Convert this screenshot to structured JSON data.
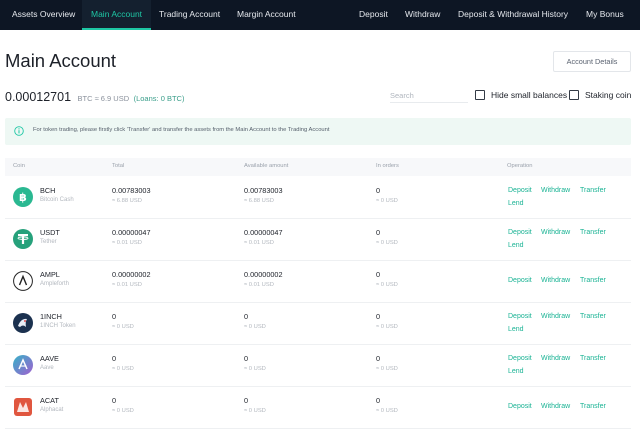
{
  "nav": {
    "left": [
      "Assets Overview",
      "Main Account",
      "Trading Account",
      "Margin Account"
    ],
    "right": [
      "Deposit",
      "Withdraw",
      "Deposit & Withdrawal History",
      "My Bonus"
    ]
  },
  "page": {
    "title": "Main Account",
    "details_label": "Account Details"
  },
  "balance": {
    "amount": "0.00012701",
    "sub": "BTC ≈ 6.9 USD",
    "loans": "(Loans: 0 BTC)"
  },
  "filters": {
    "search_placeholder": "Search",
    "hide_small_label": "Hide small balances",
    "staking_label": "Staking coin"
  },
  "notice": {
    "text": "For token trading, please firstly click 'Transfer' and transfer the assets from the Main Account to the Trading Account"
  },
  "table": {
    "headers": [
      "Coin",
      "Total",
      "Available amount",
      "In orders",
      "Operation"
    ],
    "op_labels": {
      "deposit": "Deposit",
      "withdraw": "Withdraw",
      "transfer": "Transfer",
      "lend": "Lend"
    },
    "rows": [
      {
        "symbol": "BCH",
        "name": "Bitcoin Cash",
        "icon": "bch-icon",
        "color": "#2ab891",
        "total": "0.00783003",
        "total_usd": "≈ 6.88 USD",
        "available": "0.00783003",
        "available_usd": "≈ 6.88 USD",
        "in_orders": "0",
        "in_orders_usd": "≈ 0 USD",
        "ops": [
          "deposit",
          "withdraw",
          "transfer",
          "lend"
        ]
      },
      {
        "symbol": "USDT",
        "name": "Tether",
        "icon": "usdt-icon",
        "color": "#26a17b",
        "total": "0.00000047",
        "total_usd": "≈ 0.01 USD",
        "available": "0.00000047",
        "available_usd": "≈ 0.01 USD",
        "in_orders": "0",
        "in_orders_usd": "≈ 0 USD",
        "ops": [
          "deposit",
          "withdraw",
          "transfer",
          "lend"
        ]
      },
      {
        "symbol": "AMPL",
        "name": "Ampleforth",
        "icon": "ampl-icon",
        "color": "#ffffff",
        "total": "0.00000002",
        "total_usd": "≈ 0.01 USD",
        "available": "0.00000002",
        "available_usd": "≈ 0.01 USD",
        "in_orders": "0",
        "in_orders_usd": "≈ 0 USD",
        "ops": [
          "deposit",
          "withdraw",
          "transfer"
        ]
      },
      {
        "symbol": "1INCH",
        "name": "1INCH Token",
        "icon": "1inch-icon",
        "color": "#1b314f",
        "total": "0",
        "total_usd": "≈ 0 USD",
        "available": "0",
        "available_usd": "≈ 0 USD",
        "in_orders": "0",
        "in_orders_usd": "≈ 0 USD",
        "ops": [
          "deposit",
          "withdraw",
          "transfer",
          "lend"
        ]
      },
      {
        "symbol": "AAVE",
        "name": "Aave",
        "icon": "aave-icon",
        "color": "#7b63c9",
        "total": "0",
        "total_usd": "≈ 0 USD",
        "available": "0",
        "available_usd": "≈ 0 USD",
        "in_orders": "0",
        "in_orders_usd": "≈ 0 USD",
        "ops": [
          "deposit",
          "withdraw",
          "transfer",
          "lend"
        ]
      },
      {
        "symbol": "ACAT",
        "name": "Alphacat",
        "icon": "acat-icon",
        "color": "#e0563f",
        "total": "0",
        "total_usd": "≈ 0 USD",
        "available": "0",
        "available_usd": "≈ 0 USD",
        "in_orders": "0",
        "in_orders_usd": "≈ 0 USD",
        "ops": [
          "deposit",
          "withdraw",
          "transfer"
        ]
      }
    ]
  },
  "colors": {
    "nav_bg": "#0d1624",
    "accent": "#1ec7a5",
    "link": "#1ab394",
    "notice_bg": "#eef8f4"
  }
}
